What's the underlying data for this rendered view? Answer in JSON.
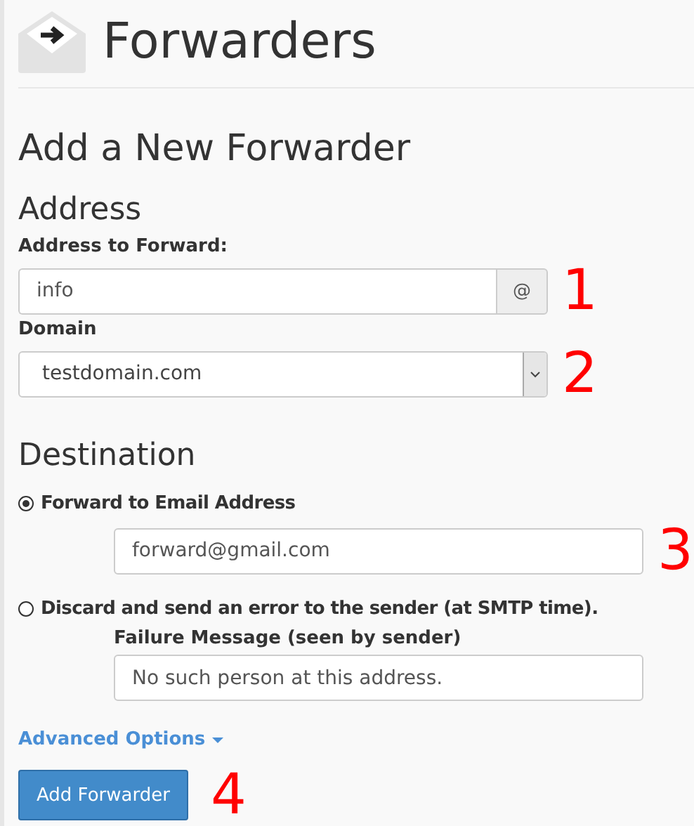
{
  "page": {
    "title": "Forwarders"
  },
  "form": {
    "heading": "Add a New Forwarder",
    "address": {
      "heading": "Address",
      "address_label": "Address to Forward:",
      "address_value": "info",
      "address_addon": "@",
      "address_marker": "1",
      "domain_label": "Domain",
      "domain_value": "testdomain.com",
      "domain_marker": "2"
    },
    "destination": {
      "heading": "Destination",
      "options": [
        {
          "label": "Forward to Email Address",
          "selected": true,
          "value": "forward@gmail.com",
          "marker": "3"
        },
        {
          "label": "Discard and send an error to the sender (at SMTP time).",
          "selected": false,
          "field_label": "Failure Message (seen by sender)",
          "value": "No such person at this address."
        }
      ]
    },
    "advanced_link": "Advanced Options",
    "submit": {
      "label": "Add Forwarder",
      "marker": "4"
    }
  }
}
